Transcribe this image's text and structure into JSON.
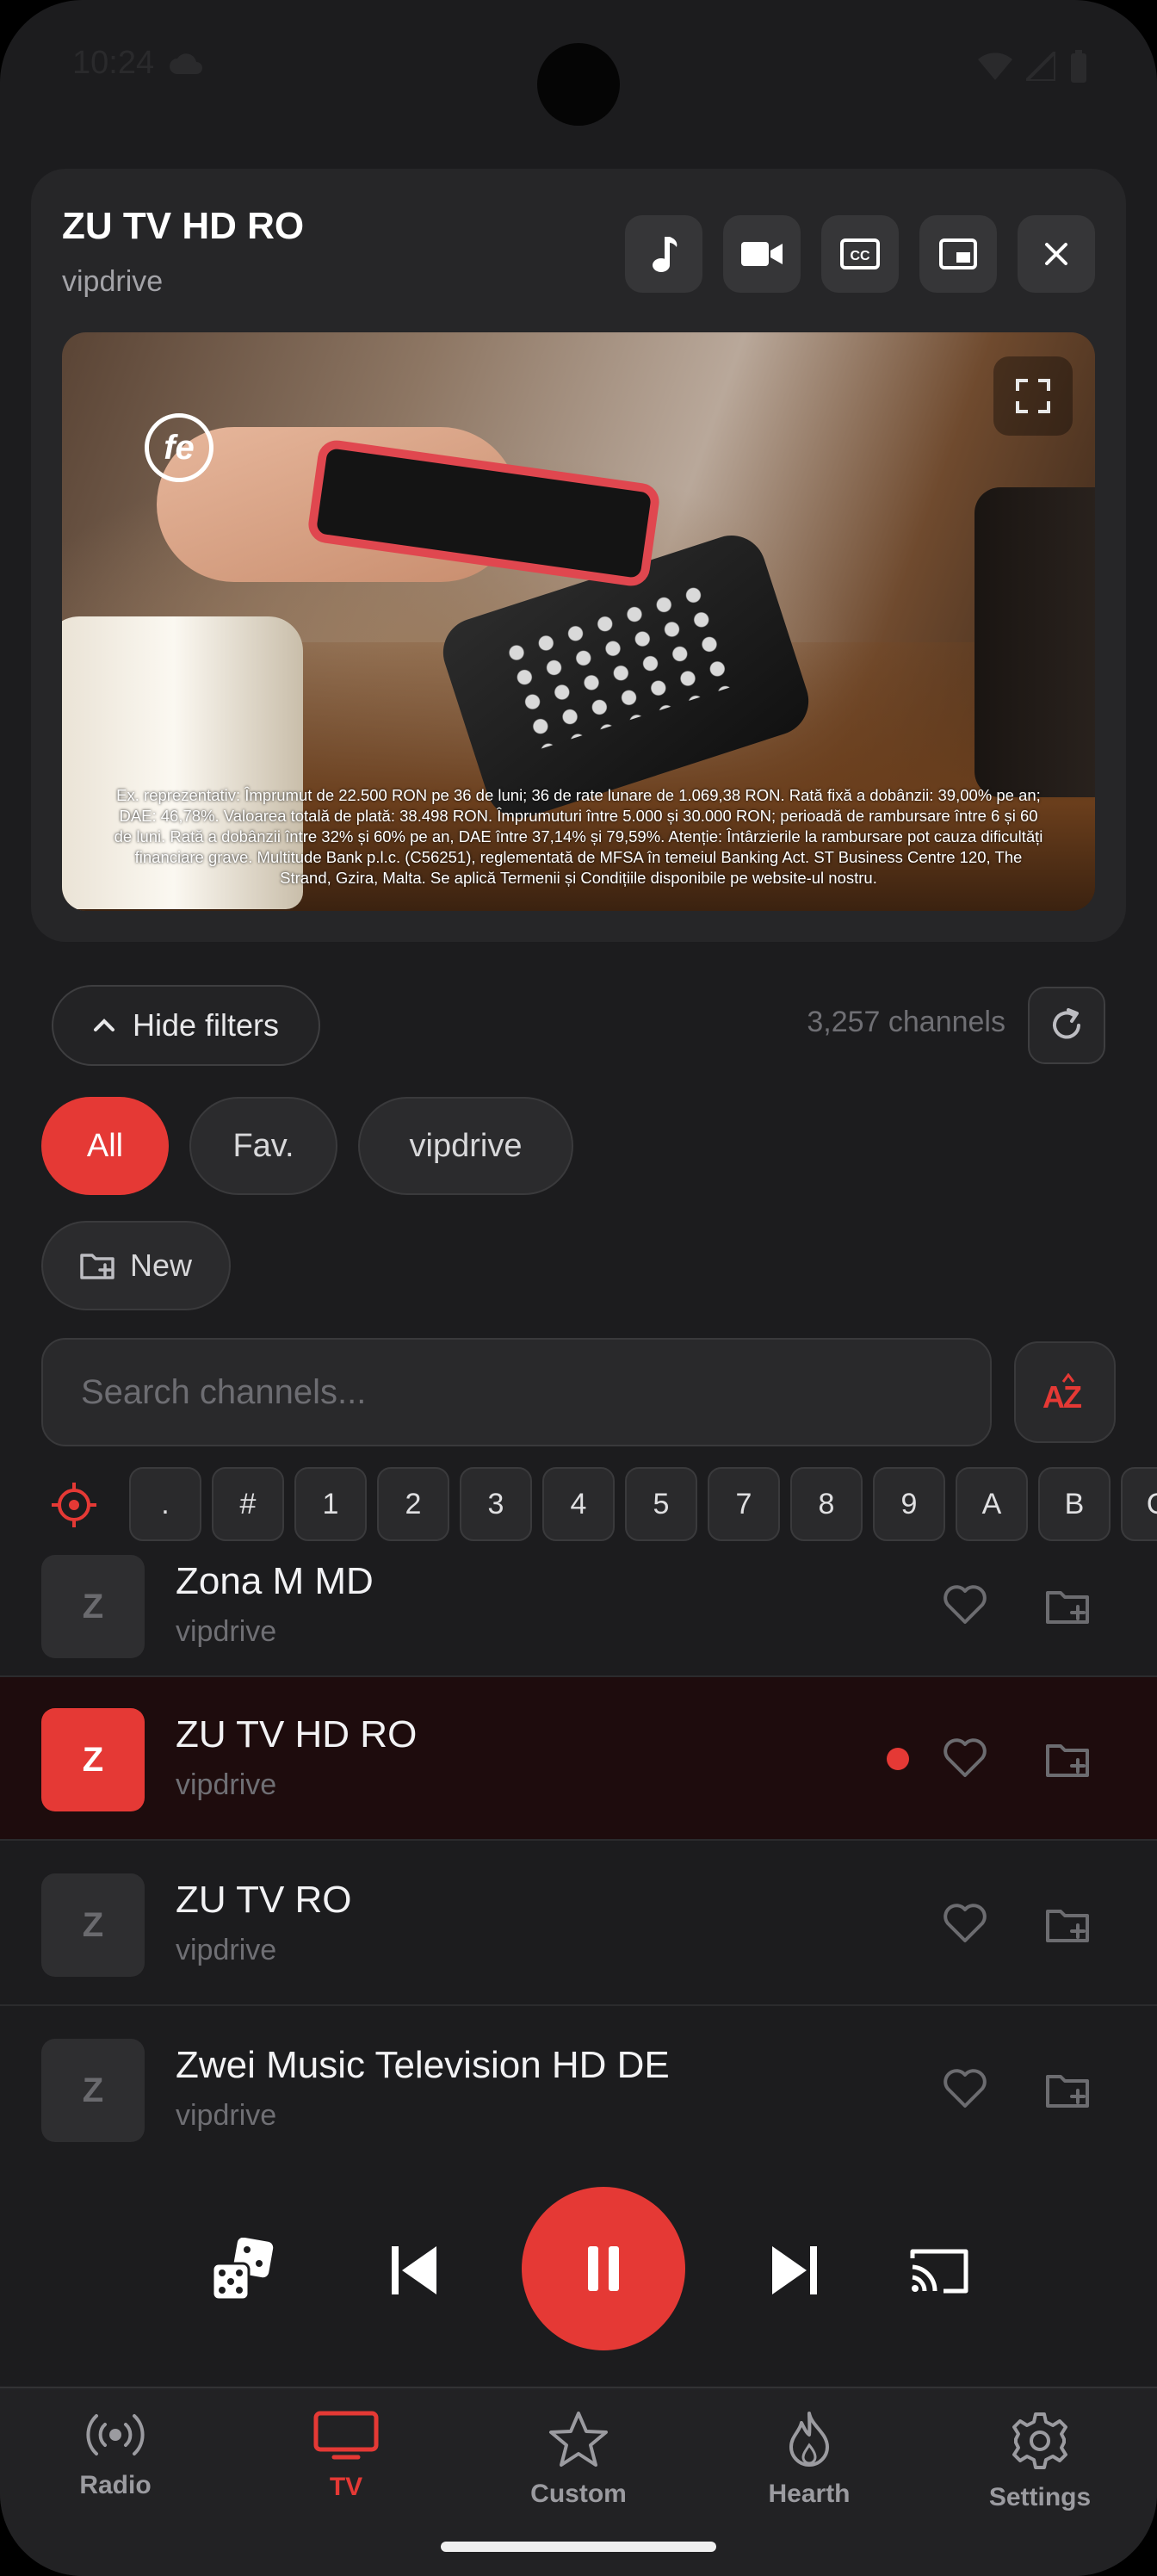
{
  "status_bar": {
    "time": "10:24"
  },
  "player": {
    "title": "ZU TV HD RO",
    "subtitle": "vipdrive",
    "actions": [
      {
        "name": "audio-track-button",
        "icon": "music-note-icon"
      },
      {
        "name": "video-track-button",
        "icon": "video-camera-icon"
      },
      {
        "name": "subtitles-button",
        "icon": "closed-captions-icon"
      },
      {
        "name": "picture-in-picture-button",
        "icon": "pip-icon"
      },
      {
        "name": "close-player-button",
        "icon": "close-icon"
      }
    ],
    "video": {
      "logo_text": "fe",
      "disclaimer": "Ex. reprezentativ: Împrumut de 22.500 RON pe 36 de luni; 36 de rate lunare de 1.069,38 RON. Rată fixă a dobânzii: 39,00% pe an; DAE: 46,78%. Valoarea totală de plată: 38.498 RON. Împrumuturi între 5.000 și 30.000 RON; perioadă de rambursare între 6 și 60 de luni. Rată a dobânzii între 32% și 60% pe an, DAE între 37,14% și 79,59%. Atenție: Întârzierile la rambursare pot cauza dificultăți financiare grave. Multitude Bank p.l.c. (C56251), reglementată de MFSA în temeiul Banking Act. ST Business Centre 120, The Strand, Gzira, Malta. Se aplică Termenii și Condițiile disponibile pe website-ul nostru."
    }
  },
  "filters": {
    "toggle_label": "Hide filters",
    "channel_count": "3,257 channels",
    "chips": {
      "all": "All",
      "fav": "Fav.",
      "vipdrive": "vipdrive"
    },
    "new_label": "New"
  },
  "search": {
    "placeholder": "Search channels...",
    "sort_label": "AZ"
  },
  "alpha_index": [
    ".",
    "#",
    "1",
    "2",
    "3",
    "4",
    "5",
    "7",
    "8",
    "9",
    "A",
    "B",
    "C"
  ],
  "channels": [
    {
      "initial": "Z",
      "name": "Zona M MD",
      "source": "vipdrive",
      "playing": false
    },
    {
      "initial": "Z",
      "name": "ZU TV HD RO",
      "source": "vipdrive",
      "playing": true
    },
    {
      "initial": "Z",
      "name": "ZU TV RO",
      "source": "vipdrive",
      "playing": false
    },
    {
      "initial": "Z",
      "name": "Zwei Music Television HD DE",
      "source": "vipdrive",
      "playing": false
    }
  ],
  "bottom_nav": [
    {
      "label": "Radio",
      "icon": "radio-broadcast-icon",
      "active": false
    },
    {
      "label": "TV",
      "icon": "tv-icon",
      "active": true
    },
    {
      "label": "Custom",
      "icon": "star-icon",
      "active": false
    },
    {
      "label": "Hearth",
      "icon": "flame-icon",
      "active": false
    },
    {
      "label": "Settings",
      "icon": "gear-icon",
      "active": false
    }
  ],
  "colors": {
    "accent": "#e53935",
    "background": "#1c1c1e",
    "card": "#262628"
  }
}
